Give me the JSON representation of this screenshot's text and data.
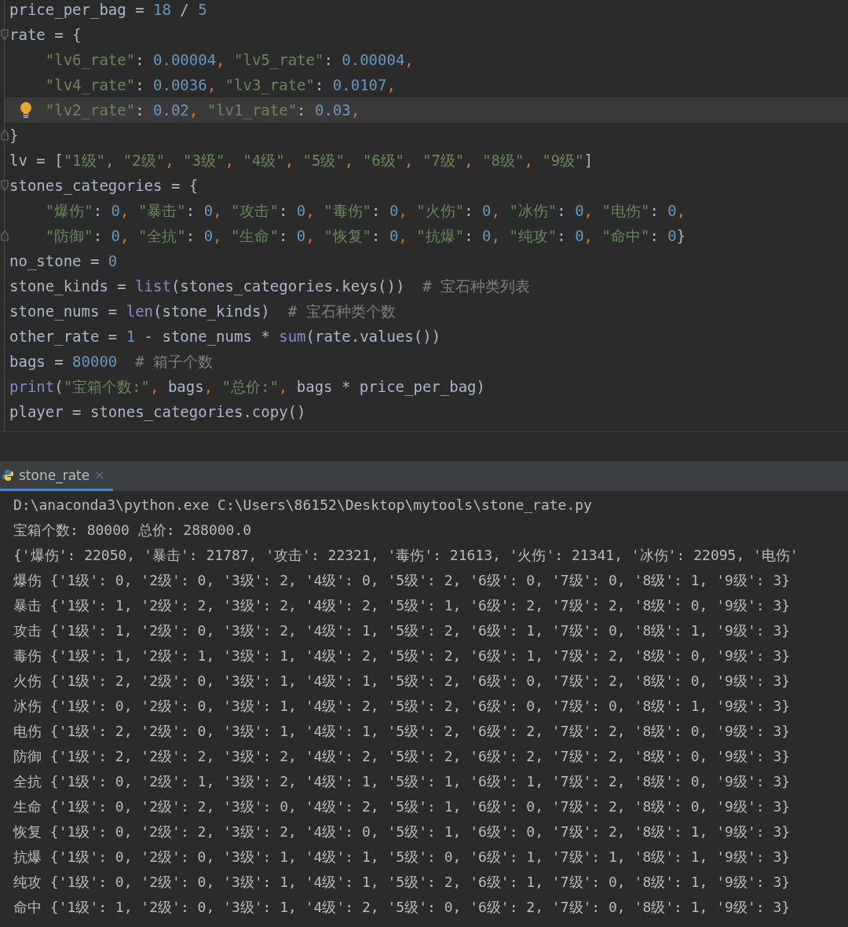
{
  "editor": {
    "lines": [
      {
        "current": false,
        "segments": [
          {
            "kind": "code",
            "text": "price_per_bag = "
          },
          {
            "kind": "number",
            "text": "18"
          },
          {
            "kind": "code",
            "text": " / "
          },
          {
            "kind": "number",
            "text": "5"
          }
        ]
      },
      {
        "current": false,
        "gutter": {
          "kind": "fold-start"
        },
        "segments": [
          {
            "kind": "code",
            "text": "rate = {"
          }
        ]
      },
      {
        "current": false,
        "indented": true,
        "segments": [
          {
            "kind": "string",
            "text": "\"lv6_rate\""
          },
          {
            "kind": "code",
            "text": ": "
          },
          {
            "kind": "number",
            "text": "0.00004"
          },
          {
            "kind": "comma",
            "text": ", "
          },
          {
            "kind": "string",
            "text": "\"lv5_rate\""
          },
          {
            "kind": "code",
            "text": ": "
          },
          {
            "kind": "number",
            "text": "0.00004"
          },
          {
            "kind": "comma",
            "text": ","
          }
        ]
      },
      {
        "current": false,
        "indented": true,
        "segments": [
          {
            "kind": "string",
            "text": "\"lv4_rate\""
          },
          {
            "kind": "code",
            "text": ": "
          },
          {
            "kind": "number",
            "text": "0.0036"
          },
          {
            "kind": "comma",
            "text": ", "
          },
          {
            "kind": "string",
            "text": "\"lv3_rate\""
          },
          {
            "kind": "code",
            "text": ": "
          },
          {
            "kind": "number",
            "text": "0.0107"
          },
          {
            "kind": "comma",
            "text": ","
          }
        ]
      },
      {
        "current": true,
        "indented": true,
        "gutter": {
          "kind": "bulb"
        },
        "segments": [
          {
            "kind": "string",
            "text": "\"lv2_rate\""
          },
          {
            "kind": "code",
            "text": ": "
          },
          {
            "kind": "number",
            "text": "0.02"
          },
          {
            "kind": "comma",
            "text": ", "
          },
          {
            "kind": "string",
            "text": "\"lv1_rate\""
          },
          {
            "kind": "code",
            "text": ": "
          },
          {
            "kind": "number",
            "text": "0.03"
          },
          {
            "kind": "comma",
            "text": ","
          }
        ]
      },
      {
        "current": false,
        "gutter": {
          "kind": "fold-end"
        },
        "segments": [
          {
            "kind": "code",
            "text": "}"
          }
        ]
      },
      {
        "current": false,
        "segments": [
          {
            "kind": "code",
            "text": "lv = ["
          },
          {
            "kind": "string",
            "text": "\"1级\""
          },
          {
            "kind": "comma",
            "text": ", "
          },
          {
            "kind": "string",
            "text": "\"2级\""
          },
          {
            "kind": "comma",
            "text": ", "
          },
          {
            "kind": "string",
            "text": "\"3级\""
          },
          {
            "kind": "comma",
            "text": ", "
          },
          {
            "kind": "string",
            "text": "\"4级\""
          },
          {
            "kind": "comma",
            "text": ", "
          },
          {
            "kind": "string",
            "text": "\"5级\""
          },
          {
            "kind": "comma",
            "text": ", "
          },
          {
            "kind": "string",
            "text": "\"6级\""
          },
          {
            "kind": "comma",
            "text": ", "
          },
          {
            "kind": "string",
            "text": "\"7级\""
          },
          {
            "kind": "comma",
            "text": ", "
          },
          {
            "kind": "string",
            "text": "\"8级\""
          },
          {
            "kind": "comma",
            "text": ", "
          },
          {
            "kind": "string",
            "text": "\"9级\""
          },
          {
            "kind": "code",
            "text": "]"
          }
        ]
      },
      {
        "current": false,
        "gutter": {
          "kind": "fold-start"
        },
        "segments": [
          {
            "kind": "code",
            "text": "stones_categories = {"
          }
        ]
      },
      {
        "current": false,
        "indented": true,
        "segments": [
          {
            "kind": "string",
            "text": "\"爆伤\""
          },
          {
            "kind": "code",
            "text": ": "
          },
          {
            "kind": "number",
            "text": "0"
          },
          {
            "kind": "comma",
            "text": ", "
          },
          {
            "kind": "string",
            "text": "\"暴击\""
          },
          {
            "kind": "code",
            "text": ": "
          },
          {
            "kind": "number",
            "text": "0"
          },
          {
            "kind": "comma",
            "text": ", "
          },
          {
            "kind": "string",
            "text": "\"攻击\""
          },
          {
            "kind": "code",
            "text": ": "
          },
          {
            "kind": "number",
            "text": "0"
          },
          {
            "kind": "comma",
            "text": ", "
          },
          {
            "kind": "string",
            "text": "\"毒伤\""
          },
          {
            "kind": "code",
            "text": ": "
          },
          {
            "kind": "number",
            "text": "0"
          },
          {
            "kind": "comma",
            "text": ", "
          },
          {
            "kind": "string",
            "text": "\"火伤\""
          },
          {
            "kind": "code",
            "text": ": "
          },
          {
            "kind": "number",
            "text": "0"
          },
          {
            "kind": "comma",
            "text": ", "
          },
          {
            "kind": "string",
            "text": "\"冰伤\""
          },
          {
            "kind": "code",
            "text": ": "
          },
          {
            "kind": "number",
            "text": "0"
          },
          {
            "kind": "comma",
            "text": ", "
          },
          {
            "kind": "string",
            "text": "\"电伤\""
          },
          {
            "kind": "code",
            "text": ": "
          },
          {
            "kind": "number",
            "text": "0"
          },
          {
            "kind": "comma",
            "text": ","
          }
        ]
      },
      {
        "current": false,
        "indented": true,
        "gutter": {
          "kind": "fold-end"
        },
        "segments": [
          {
            "kind": "string",
            "text": "\"防御\""
          },
          {
            "kind": "code",
            "text": ": "
          },
          {
            "kind": "number",
            "text": "0"
          },
          {
            "kind": "comma",
            "text": ", "
          },
          {
            "kind": "string",
            "text": "\"全抗\""
          },
          {
            "kind": "code",
            "text": ": "
          },
          {
            "kind": "number",
            "text": "0"
          },
          {
            "kind": "comma",
            "text": ", "
          },
          {
            "kind": "string",
            "text": "\"生命\""
          },
          {
            "kind": "code",
            "text": ": "
          },
          {
            "kind": "number",
            "text": "0"
          },
          {
            "kind": "comma",
            "text": ", "
          },
          {
            "kind": "string",
            "text": "\"恢复\""
          },
          {
            "kind": "code",
            "text": ": "
          },
          {
            "kind": "number",
            "text": "0"
          },
          {
            "kind": "comma",
            "text": ", "
          },
          {
            "kind": "string",
            "text": "\"抗爆\""
          },
          {
            "kind": "code",
            "text": ": "
          },
          {
            "kind": "number",
            "text": "0"
          },
          {
            "kind": "comma",
            "text": ", "
          },
          {
            "kind": "string",
            "text": "\"纯攻\""
          },
          {
            "kind": "code",
            "text": ": "
          },
          {
            "kind": "number",
            "text": "0"
          },
          {
            "kind": "comma",
            "text": ", "
          },
          {
            "kind": "string",
            "text": "\"命中\""
          },
          {
            "kind": "code",
            "text": ": "
          },
          {
            "kind": "number",
            "text": "0"
          },
          {
            "kind": "code",
            "text": "}"
          }
        ]
      },
      {
        "current": false,
        "segments": [
          {
            "kind": "code",
            "text": "no_stone = "
          },
          {
            "kind": "number",
            "text": "0"
          }
        ]
      },
      {
        "current": false,
        "segments": [
          {
            "kind": "code",
            "text": "stone_kinds = "
          },
          {
            "kind": "builtin",
            "text": "list"
          },
          {
            "kind": "code",
            "text": "(stones_categories.keys())"
          },
          {
            "kind": "comment",
            "text": "# 宝石种类列表"
          }
        ]
      },
      {
        "current": false,
        "segments": [
          {
            "kind": "code",
            "text": "stone_nums = "
          },
          {
            "kind": "builtin",
            "text": "len"
          },
          {
            "kind": "code",
            "text": "(stone_kinds)"
          },
          {
            "kind": "comment",
            "text": "# 宝石种类个数"
          }
        ]
      },
      {
        "current": false,
        "segments": [
          {
            "kind": "code",
            "text": "other_rate = "
          },
          {
            "kind": "number",
            "text": "1"
          },
          {
            "kind": "code",
            "text": " - stone_nums * "
          },
          {
            "kind": "builtin",
            "text": "sum"
          },
          {
            "kind": "code",
            "text": "(rate.values())"
          }
        ]
      },
      {
        "current": false,
        "segments": [
          {
            "kind": "code",
            "text": "bags = "
          },
          {
            "kind": "number",
            "text": "80000"
          },
          {
            "kind": "comment",
            "text": "# 箱子个数"
          }
        ]
      },
      {
        "current": false,
        "segments": [
          {
            "kind": "builtin",
            "text": "print"
          },
          {
            "kind": "code",
            "text": "("
          },
          {
            "kind": "string",
            "text": "\"宝箱个数:\""
          },
          {
            "kind": "comma",
            "text": ", "
          },
          {
            "kind": "code",
            "text": "bags"
          },
          {
            "kind": "comma",
            "text": ", "
          },
          {
            "kind": "string",
            "text": "\"总价:\""
          },
          {
            "kind": "comma",
            "text": ", "
          },
          {
            "kind": "code",
            "text": "bags * price_per_bag)"
          }
        ]
      },
      {
        "current": false,
        "segments": [
          {
            "kind": "code",
            "text": "player = stones_categories.copy()"
          }
        ]
      }
    ]
  },
  "run_panel": {
    "tab": {
      "label": "stone_rate",
      "selected": true,
      "close": "×"
    },
    "output": [
      "D:\\anaconda3\\python.exe C:\\Users\\86152\\Desktop\\mytools\\stone_rate.py",
      "宝箱个数: 80000 总价: 288000.0",
      "{'爆伤': 22050, '暴击': 21787, '攻击': 22321, '毒伤': 21613, '火伤': 21341, '冰伤': 22095, '电伤'",
      "爆伤 {'1级': 0, '2级': 0, '3级': 2, '4级': 0, '5级': 2, '6级': 0, '7级': 0, '8级': 1, '9级': 3}",
      "暴击 {'1级': 1, '2级': 2, '3级': 2, '4级': 2, '5级': 1, '6级': 2, '7级': 2, '8级': 0, '9级': 3}",
      "攻击 {'1级': 1, '2级': 0, '3级': 2, '4级': 1, '5级': 2, '6级': 1, '7级': 0, '8级': 1, '9级': 3}",
      "毒伤 {'1级': 1, '2级': 1, '3级': 1, '4级': 2, '5级': 2, '6级': 1, '7级': 2, '8级': 0, '9级': 3}",
      "火伤 {'1级': 2, '2级': 0, '3级': 1, '4级': 1, '5级': 2, '6级': 0, '7级': 2, '8级': 0, '9级': 3}",
      "冰伤 {'1级': 0, '2级': 0, '3级': 1, '4级': 2, '5级': 2, '6级': 0, '7级': 0, '8级': 1, '9级': 3}",
      "电伤 {'1级': 2, '2级': 0, '3级': 1, '4级': 1, '5级': 2, '6级': 2, '7级': 2, '8级': 0, '9级': 3}",
      "防御 {'1级': 2, '2级': 2, '3级': 2, '4级': 2, '5级': 2, '6级': 2, '7级': 2, '8级': 0, '9级': 3}",
      "全抗 {'1级': 0, '2级': 1, '3级': 2, '4级': 1, '5级': 1, '6级': 1, '7级': 2, '8级': 0, '9级': 3}",
      "生命 {'1级': 0, '2级': 2, '3级': 0, '4级': 2, '5级': 1, '6级': 0, '7级': 2, '8级': 0, '9级': 3}",
      "恢复 {'1级': 0, '2级': 2, '3级': 2, '4级': 0, '5级': 1, '6级': 0, '7级': 2, '8级': 1, '9级': 3}",
      "抗爆 {'1级': 0, '2级': 0, '3级': 1, '4级': 1, '5级': 0, '6级': 1, '7级': 1, '8级': 1, '9级': 3}",
      "纯攻 {'1级': 0, '2级': 0, '3级': 1, '4级': 1, '5级': 2, '6级': 1, '7级': 0, '8级': 1, '9级': 3}",
      "命中 {'1级': 1, '2级': 0, '3级': 1, '4级': 2, '5级': 0, '6级': 2, '7级': 0, '8级': 1, '9级': 3}"
    ]
  }
}
